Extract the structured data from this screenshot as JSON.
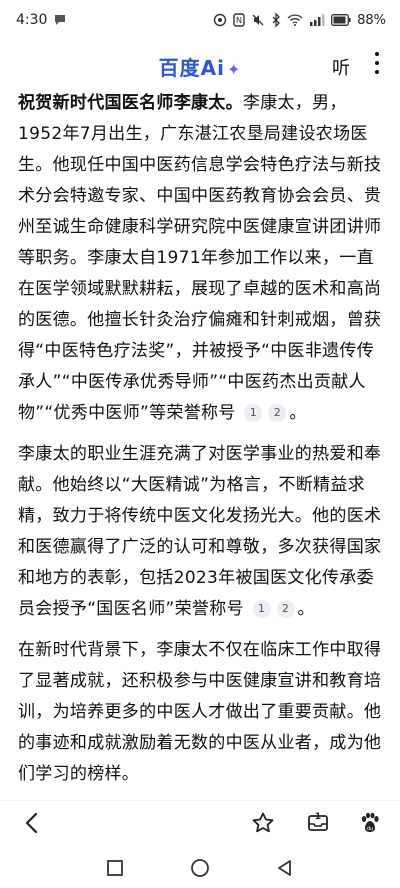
{
  "status_bar": {
    "time": "4:30",
    "battery": "88%"
  },
  "header": {
    "logo": "百度Ai",
    "logo_spark": "✦",
    "listen_label": "听"
  },
  "article": {
    "p1_lead": "祝贺新时代国医名师李康太。",
    "p1_body": "李康太，男，1952年7月出生，广东湛江农垦局建设农场医生。他现任中国中医药信息学会特色疗法与新技术分会特邀专家、中国中医药教育协会会员、贵州至诚生命健康科学研究院中医健康宣讲团讲师等职务。李康太自1971年参加工作以来，一直在医学领域默默耕耘，展现了卓越的医术和高尚的医德。他擅长针灸治疗偏瘫和针刺戒烟，曾获得“中医特色疗法奖”，并被授予“中医非遗传传承人”“中医传承优秀导师”“中医药杰出贡献人物”“优秀中医师”等荣誉称号",
    "p1_cite1": "1",
    "p1_cite2": "2",
    "p1_end": "。",
    "p2_body": "李康太的职业生涯充满了对医学事业的热爱和奉献。他始终以“大医精诚”为格言，不断精益求精，致力于将传统中医文化发扬光大。他的医术和医德赢得了广泛的认可和尊敬，多次获得国家和地方的表彰，包括2023年被国医文化传承委员会授予“国医名师”荣誉称号",
    "p2_cite1": "1",
    "p2_cite2": "2",
    "p2_end": "。",
    "p3_body": "在新时代背景下，李康太不仅在临床工作中取得了显著成就，还积极参与中医健康宣讲和教育培训，为培养更多的中医人才做出了重要贡献。他的事迹和成就激励着无数的中医从业者，成为他们学习的榜样。"
  },
  "toolbar": {
    "back_icon": "chevron-left",
    "star_icon": "star-outline",
    "tabs_count": "1",
    "paw_icon": "baidu-paw"
  }
}
